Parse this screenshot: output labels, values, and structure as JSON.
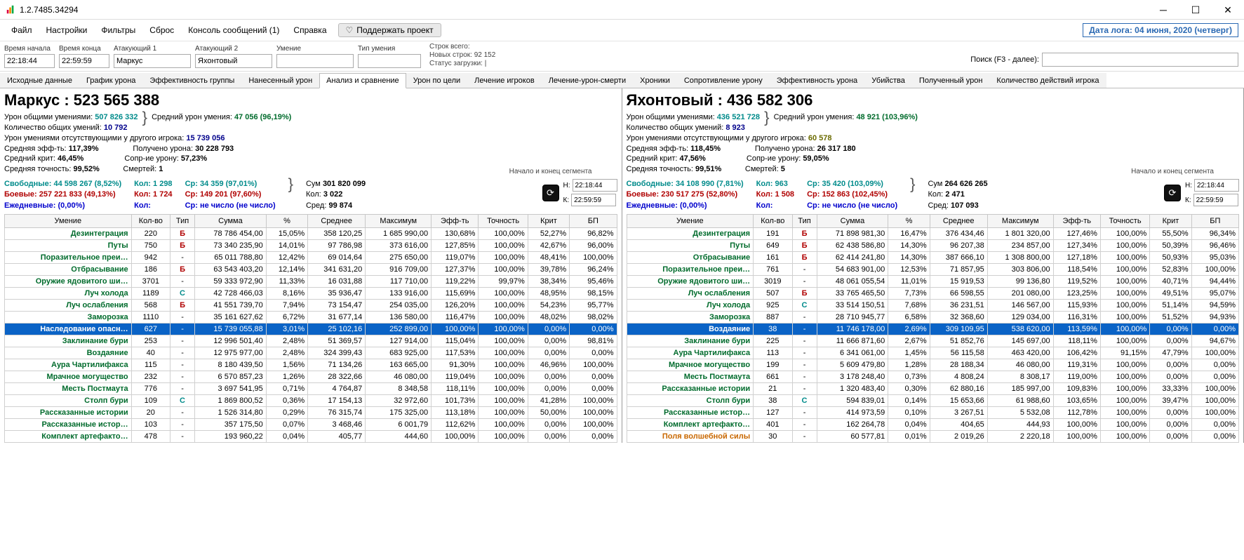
{
  "window": {
    "title": "1.2.7485.34294"
  },
  "menu": {
    "file": "Файл",
    "settings": "Настройки",
    "filters": "Фильтры",
    "reset": "Сброс",
    "console": "Консоль сообщений (1)",
    "help": "Справка",
    "support": "Поддержать проект"
  },
  "date_badge": "Дата лога: 04 июня, 2020  (четверг)",
  "toolbar": {
    "time_start_label": "Время начала",
    "time_start": "22:18:44",
    "time_end_label": "Время конца",
    "time_end": "22:59:59",
    "attacker1_label": "Атакующий 1",
    "attacker1": "Маркус",
    "attacker2_label": "Атакующий 2",
    "attacker2": "Яхонтовый",
    "skill_label": "Умение",
    "skill": "",
    "skill_type_label": "Тип умения",
    "skill_type": "",
    "lines_total": "Строк всего:",
    "lines_new": "Новых строк: 92 152",
    "load_status": "Статус загрузки: |",
    "search_label": "Поиск (F3 - далее):"
  },
  "tabs": [
    "Исходные данные",
    "График урона",
    "Эффективность группы",
    "Нанесенный урон",
    "Анализ и сравнение",
    "Урон по цели",
    "Лечение игроков",
    "Лечение-урон-смерти",
    "Хроники",
    "Сопротивление урону",
    "Эффективность урона",
    "Убийства",
    "Полученный урон",
    "Количество действий игрока"
  ],
  "active_tab": 4,
  "segment_label": "Начало и конец\nсегмента",
  "time_spins": {
    "H": "22:18:44",
    "K": "22:59:59"
  },
  "columns": [
    "Умение",
    "Кол-во",
    "Тип",
    "Сумма",
    "%",
    "Среднее",
    "Максимум",
    "Эфф-ть",
    "Точность",
    "Крит",
    "БП"
  ],
  "left": {
    "title": "Маркус : 523 565 388",
    "l1a": "Урон общими умениями:",
    "l1b": "507 826 332",
    "l1c": "Средний урон умения:",
    "l1d": "47 056 (96,19%)",
    "l2a": "Количество общих умений:",
    "l2b": "10 792",
    "l3a": "Урон умениями отсутствующими у другого игрока:",
    "l3b": "15 739 056",
    "l4a": "Средняя эфф-ть:",
    "l4b": "117,39%",
    "l4c": "Получено урона:",
    "l4d": "30 228 793",
    "l5a": "Средний крит:",
    "l5b": "46,45%",
    "l5c": "Сопр-ие урону:",
    "l5d": "57,23%",
    "l6a": "Средняя точность:",
    "l6b": "99,52%",
    "l6c": "Смертей:",
    "l6d": "1",
    "free_lbl": "Свободные:",
    "free_val": "44 598 267 (8,52%)",
    "combat_lbl": "Боевые:",
    "combat_val": "257 221 833 (49,13%)",
    "daily_lbl": "Ежедневные:",
    "daily_val": "(0,00%)",
    "cnt1": "Кол: 1 298",
    "cnt2": "Кол: 1 724",
    "cnt3": "Кол:",
    "avg1": "Ср: 34 359 (97,01%)",
    "avg2": "Ср: 149 201 (97,60%)",
    "avg3": "Ср: не число (не число)",
    "sum_lbl": "Сум",
    "sum_val": "301 820 099",
    "kol_lbl": "Кол:",
    "kol_val": "3 022",
    "sred_lbl": "Сред:",
    "sred_val": "99 874",
    "rows": [
      [
        "Дезинтеграция",
        "220",
        "Б",
        "78 786 454,00",
        "15,05%",
        "358 120,25",
        "1 685 990,00",
        "130,68%",
        "100,00%",
        "52,27%",
        "96,82%"
      ],
      [
        "Путы",
        "750",
        "Б",
        "73 340 235,90",
        "14,01%",
        "97 786,98",
        "373 616,00",
        "127,85%",
        "100,00%",
        "42,67%",
        "96,00%"
      ],
      [
        "Поразительное преи…",
        "942",
        "-",
        "65 011 788,80",
        "12,42%",
        "69 014,64",
        "275 650,00",
        "119,07%",
        "100,00%",
        "48,41%",
        "100,00%"
      ],
      [
        "Отбрасывание",
        "186",
        "Б",
        "63 543 403,20",
        "12,14%",
        "341 631,20",
        "916 709,00",
        "127,37%",
        "100,00%",
        "39,78%",
        "96,24%"
      ],
      [
        "Оружие ядовитого ши…",
        "3701",
        "-",
        "59 333 972,90",
        "11,33%",
        "16 031,88",
        "117 710,00",
        "119,22%",
        "99,97%",
        "38,34%",
        "95,46%"
      ],
      [
        "Луч холода",
        "1189",
        "С",
        "42 728 466,03",
        "8,16%",
        "35 936,47",
        "133 916,00",
        "115,69%",
        "100,00%",
        "48,95%",
        "98,15%"
      ],
      [
        "Луч ослабления",
        "568",
        "Б",
        "41 551 739,70",
        "7,94%",
        "73 154,47",
        "254 035,00",
        "126,20%",
        "100,00%",
        "54,23%",
        "95,77%"
      ],
      [
        "Заморозка",
        "1110",
        "-",
        "35 161 627,62",
        "6,72%",
        "31 677,14",
        "136 580,00",
        "116,47%",
        "100,00%",
        "48,02%",
        "98,02%"
      ],
      [
        "Наследование опасн…",
        "627",
        "-",
        "15 739 055,88",
        "3,01%",
        "25 102,16",
        "252 899,00",
        "100,00%",
        "100,00%",
        "0,00%",
        "0,00%"
      ],
      [
        "Заклинание бури",
        "253",
        "-",
        "12 996 501,40",
        "2,48%",
        "51 369,57",
        "127 914,00",
        "115,04%",
        "100,00%",
        "0,00%",
        "98,81%"
      ],
      [
        "Воздаяние",
        "40",
        "-",
        "12 975 977,00",
        "2,48%",
        "324 399,43",
        "683 925,00",
        "117,53%",
        "100,00%",
        "0,00%",
        "0,00%"
      ],
      [
        "Аура Чартилифакса",
        "115",
        "-",
        "8 180 439,50",
        "1,56%",
        "71 134,26",
        "163 665,00",
        "91,30%",
        "100,00%",
        "46,96%",
        "100,00%"
      ],
      [
        "Мрачное могущество",
        "232",
        "-",
        "6 570 857,23",
        "1,26%",
        "28 322,66",
        "46 080,00",
        "119,04%",
        "100,00%",
        "0,00%",
        "0,00%"
      ],
      [
        "Месть Постмаута",
        "776",
        "-",
        "3 697 541,95",
        "0,71%",
        "4 764,87",
        "8 348,58",
        "118,11%",
        "100,00%",
        "0,00%",
        "0,00%"
      ],
      [
        "Столп бури",
        "109",
        "С",
        "1 869 800,52",
        "0,36%",
        "17 154,13",
        "32 972,60",
        "101,73%",
        "100,00%",
        "41,28%",
        "100,00%"
      ],
      [
        "Рассказанные истории",
        "20",
        "-",
        "1 526 314,80",
        "0,29%",
        "76 315,74",
        "175 325,00",
        "113,18%",
        "100,00%",
        "50,00%",
        "100,00%"
      ],
      [
        "Рассказанные истор…",
        "103",
        "-",
        "357 175,50",
        "0,07%",
        "3 468,46",
        "6 001,79",
        "112,62%",
        "100,00%",
        "0,00%",
        "100,00%"
      ],
      [
        "Комплект артефакто…",
        "478",
        "-",
        "193 960,22",
        "0,04%",
        "405,77",
        "444,60",
        "100,00%",
        "100,00%",
        "0,00%",
        "0,00%"
      ]
    ],
    "selected_row": 8
  },
  "right": {
    "title": "Яхонтовый : 436 582 306",
    "l1a": "Урон общими умениями:",
    "l1b": "436 521 728",
    "l1c": "Средний урон умения:",
    "l1d": "48 921 (103,96%)",
    "l2a": "Количество общих умений:",
    "l2b": "8 923",
    "l3a": "Урон умениями отсутствующими у другого игрока:",
    "l3b": "60 578",
    "l4a": "Средняя эфф-ть:",
    "l4b": "118,45%",
    "l4c": "Получено урона:",
    "l4d": "26 317 180",
    "l5a": "Средний крит:",
    "l5b": "47,56%",
    "l5c": "Сопр-ие урону:",
    "l5d": "59,05%",
    "l6a": "Средняя точность:",
    "l6b": "99,51%",
    "l6c": "Смертей:",
    "l6d": "5",
    "free_lbl": "Свободные:",
    "free_val": "34 108 990 (7,81%)",
    "combat_lbl": "Боевые:",
    "combat_val": "230 517 275 (52,80%)",
    "daily_lbl": "Ежедневные:",
    "daily_val": "(0,00%)",
    "cnt1": "Кол: 963",
    "cnt2": "Кол: 1 508",
    "cnt3": "Кол:",
    "avg1": "Ср: 35 420 (103,09%)",
    "avg2": "Ср: 152 863 (102,45%)",
    "avg3": "Ср: не число (не число)",
    "sum_lbl": "Сум",
    "sum_val": "264 626 265",
    "kol_lbl": "Кол:",
    "kol_val": "2 471",
    "sred_lbl": "Сред:",
    "sred_val": "107 093",
    "rows": [
      [
        "Дезинтеграция",
        "191",
        "Б",
        "71 898 981,30",
        "16,47%",
        "376 434,46",
        "1 801 320,00",
        "127,46%",
        "100,00%",
        "55,50%",
        "96,34%"
      ],
      [
        "Путы",
        "649",
        "Б",
        "62 438 586,80",
        "14,30%",
        "96 207,38",
        "234 857,00",
        "127,34%",
        "100,00%",
        "50,39%",
        "96,46%"
      ],
      [
        "Отбрасывание",
        "161",
        "Б",
        "62 414 241,80",
        "14,30%",
        "387 666,10",
        "1 308 800,00",
        "127,18%",
        "100,00%",
        "50,93%",
        "95,03%"
      ],
      [
        "Поразительное преи…",
        "761",
        "-",
        "54 683 901,00",
        "12,53%",
        "71 857,95",
        "303 806,00",
        "118,54%",
        "100,00%",
        "52,83%",
        "100,00%"
      ],
      [
        "Оружие ядовитого ши…",
        "3019",
        "-",
        "48 061 055,54",
        "11,01%",
        "15 919,53",
        "99 136,80",
        "119,52%",
        "100,00%",
        "40,71%",
        "94,44%"
      ],
      [
        "Луч ослабления",
        "507",
        "Б",
        "33 765 465,50",
        "7,73%",
        "66 598,55",
        "201 080,00",
        "123,25%",
        "100,00%",
        "49,51%",
        "95,07%"
      ],
      [
        "Луч холода",
        "925",
        "С",
        "33 514 150,51",
        "7,68%",
        "36 231,51",
        "146 567,00",
        "115,93%",
        "100,00%",
        "51,14%",
        "94,59%"
      ],
      [
        "Заморозка",
        "887",
        "-",
        "28 710 945,77",
        "6,58%",
        "32 368,60",
        "129 034,00",
        "116,31%",
        "100,00%",
        "51,52%",
        "94,93%"
      ],
      [
        "Воздаяние",
        "38",
        "-",
        "11 746 178,00",
        "2,69%",
        "309 109,95",
        "538 620,00",
        "113,59%",
        "100,00%",
        "0,00%",
        "0,00%"
      ],
      [
        "Заклинание бури",
        "225",
        "-",
        "11 666 871,60",
        "2,67%",
        "51 852,76",
        "145 697,00",
        "118,11%",
        "100,00%",
        "0,00%",
        "94,67%"
      ],
      [
        "Аура Чартилифакса",
        "113",
        "-",
        "6 341 061,00",
        "1,45%",
        "56 115,58",
        "463 420,00",
        "106,42%",
        "91,15%",
        "47,79%",
        "100,00%"
      ],
      [
        "Мрачное могущество",
        "199",
        "-",
        "5 609 479,80",
        "1,28%",
        "28 188,34",
        "46 080,00",
        "119,31%",
        "100,00%",
        "0,00%",
        "0,00%"
      ],
      [
        "Месть Постмаута",
        "661",
        "-",
        "3 178 248,40",
        "0,73%",
        "4 808,24",
        "8 308,17",
        "119,00%",
        "100,00%",
        "0,00%",
        "0,00%"
      ],
      [
        "Рассказанные истории",
        "21",
        "-",
        "1 320 483,40",
        "0,30%",
        "62 880,16",
        "185 997,00",
        "109,83%",
        "100,00%",
        "33,33%",
        "100,00%"
      ],
      [
        "Столп бури",
        "38",
        "С",
        "594 839,01",
        "0,14%",
        "15 653,66",
        "61 988,60",
        "103,65%",
        "100,00%",
        "39,47%",
        "100,00%"
      ],
      [
        "Рассказанные истор…",
        "127",
        "-",
        "414 973,59",
        "0,10%",
        "3 267,51",
        "5 532,08",
        "112,78%",
        "100,00%",
        "0,00%",
        "100,00%"
      ],
      [
        "Комплект артефакто…",
        "401",
        "-",
        "162 264,78",
        "0,04%",
        "404,65",
        "444,93",
        "100,00%",
        "100,00%",
        "0,00%",
        "0,00%"
      ],
      [
        "Поля волшебной силы",
        "30",
        "-",
        "60 577,81",
        "0,01%",
        "2 019,26",
        "2 220,18",
        "100,00%",
        "100,00%",
        "0,00%",
        "0,00%"
      ]
    ],
    "selected_row": 8,
    "orange_row": 17
  }
}
